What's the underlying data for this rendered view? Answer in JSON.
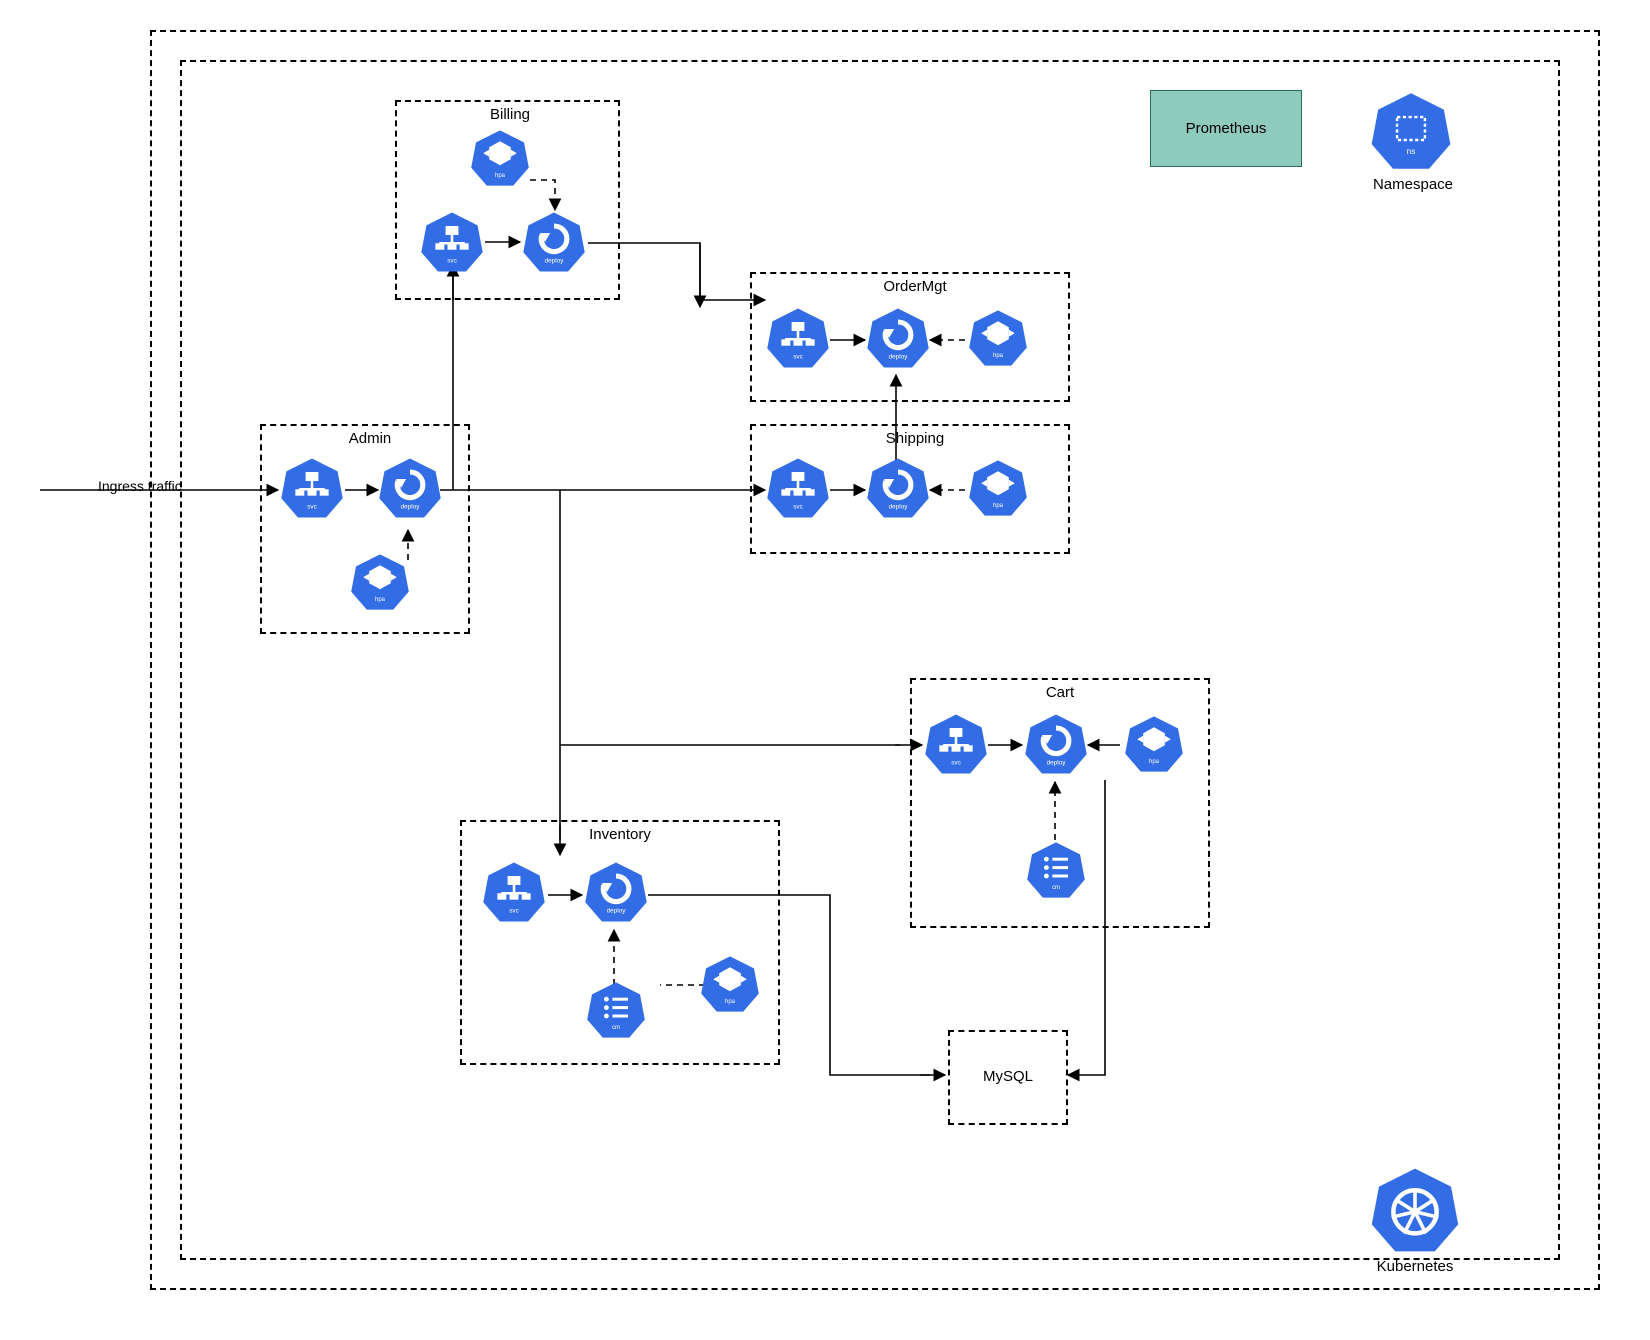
{
  "resources": {
    "svc": "svc",
    "deploy": "deploy",
    "hpa": "hpa",
    "cm": "cm",
    "ns": "ns"
  },
  "labels": {
    "namespace_outer": "Kubernetes",
    "namespace_inner": "Namespace",
    "ingress": "Ingress traffic",
    "prometheus": "Prometheus",
    "mysql": "MySQL",
    "services": {
      "admin": "Admin",
      "billing": "Billing",
      "ordermgt": "OrderMgt",
      "shipping": "Shipping",
      "cart": "Cart",
      "inventory": "Inventory"
    }
  },
  "colors": {
    "k8s": "#326de6",
    "prom": "#8fcbbd"
  }
}
